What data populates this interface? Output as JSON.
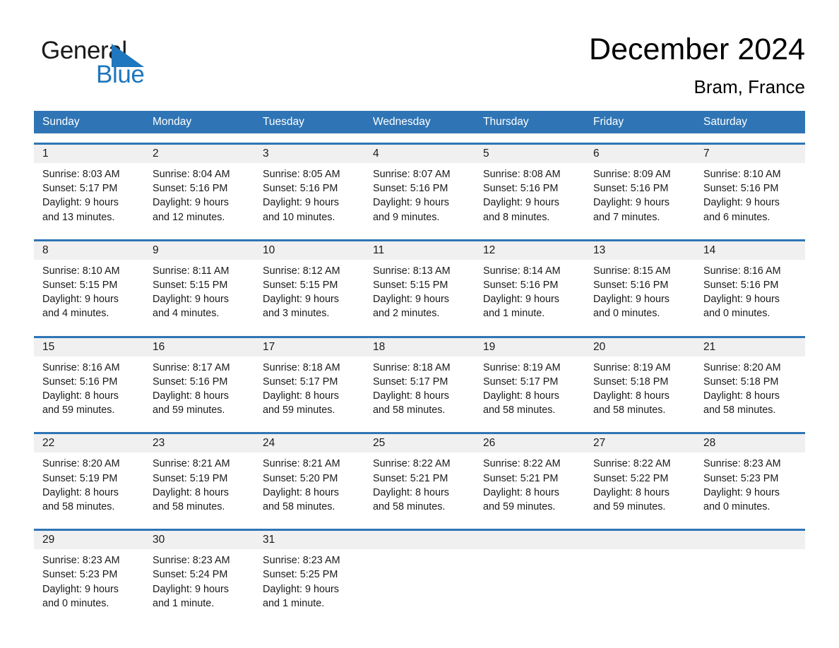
{
  "brand": {
    "name_part1": "General",
    "name_part2": "Blue",
    "logo_icon": "triangle-logo-icon",
    "accent_color": "#1f77bd"
  },
  "header": {
    "title": "December 2024",
    "location": "Bram, France"
  },
  "theme": {
    "header_row_bg": "#2f75b5",
    "daynum_band_bg": "#f0f0f0",
    "week_rule_color": "#2f75b5",
    "text_color": "#1a1a1a"
  },
  "weekdays": [
    "Sunday",
    "Monday",
    "Tuesday",
    "Wednesday",
    "Thursday",
    "Friday",
    "Saturday"
  ],
  "weeks": [
    {
      "daynums": [
        "1",
        "2",
        "3",
        "4",
        "5",
        "6",
        "7"
      ],
      "cells": [
        {
          "l1": "Sunrise: 8:03 AM",
          "l2": "Sunset: 5:17 PM",
          "l3": "Daylight: 9 hours",
          "l4": "and 13 minutes."
        },
        {
          "l1": "Sunrise: 8:04 AM",
          "l2": "Sunset: 5:16 PM",
          "l3": "Daylight: 9 hours",
          "l4": "and 12 minutes."
        },
        {
          "l1": "Sunrise: 8:05 AM",
          "l2": "Sunset: 5:16 PM",
          "l3": "Daylight: 9 hours",
          "l4": "and 10 minutes."
        },
        {
          "l1": "Sunrise: 8:07 AM",
          "l2": "Sunset: 5:16 PM",
          "l3": "Daylight: 9 hours",
          "l4": "and 9 minutes."
        },
        {
          "l1": "Sunrise: 8:08 AM",
          "l2": "Sunset: 5:16 PM",
          "l3": "Daylight: 9 hours",
          "l4": "and 8 minutes."
        },
        {
          "l1": "Sunrise: 8:09 AM",
          "l2": "Sunset: 5:16 PM",
          "l3": "Daylight: 9 hours",
          "l4": "and 7 minutes."
        },
        {
          "l1": "Sunrise: 8:10 AM",
          "l2": "Sunset: 5:16 PM",
          "l3": "Daylight: 9 hours",
          "l4": "and 6 minutes."
        }
      ]
    },
    {
      "daynums": [
        "8",
        "9",
        "10",
        "11",
        "12",
        "13",
        "14"
      ],
      "cells": [
        {
          "l1": "Sunrise: 8:10 AM",
          "l2": "Sunset: 5:15 PM",
          "l3": "Daylight: 9 hours",
          "l4": "and 4 minutes."
        },
        {
          "l1": "Sunrise: 8:11 AM",
          "l2": "Sunset: 5:15 PM",
          "l3": "Daylight: 9 hours",
          "l4": "and 4 minutes."
        },
        {
          "l1": "Sunrise: 8:12 AM",
          "l2": "Sunset: 5:15 PM",
          "l3": "Daylight: 9 hours",
          "l4": "and 3 minutes."
        },
        {
          "l1": "Sunrise: 8:13 AM",
          "l2": "Sunset: 5:15 PM",
          "l3": "Daylight: 9 hours",
          "l4": "and 2 minutes."
        },
        {
          "l1": "Sunrise: 8:14 AM",
          "l2": "Sunset: 5:16 PM",
          "l3": "Daylight: 9 hours",
          "l4": "and 1 minute."
        },
        {
          "l1": "Sunrise: 8:15 AM",
          "l2": "Sunset: 5:16 PM",
          "l3": "Daylight: 9 hours",
          "l4": "and 0 minutes."
        },
        {
          "l1": "Sunrise: 8:16 AM",
          "l2": "Sunset: 5:16 PM",
          "l3": "Daylight: 9 hours",
          "l4": "and 0 minutes."
        }
      ]
    },
    {
      "daynums": [
        "15",
        "16",
        "17",
        "18",
        "19",
        "20",
        "21"
      ],
      "cells": [
        {
          "l1": "Sunrise: 8:16 AM",
          "l2": "Sunset: 5:16 PM",
          "l3": "Daylight: 8 hours",
          "l4": "and 59 minutes."
        },
        {
          "l1": "Sunrise: 8:17 AM",
          "l2": "Sunset: 5:16 PM",
          "l3": "Daylight: 8 hours",
          "l4": "and 59 minutes."
        },
        {
          "l1": "Sunrise: 8:18 AM",
          "l2": "Sunset: 5:17 PM",
          "l3": "Daylight: 8 hours",
          "l4": "and 59 minutes."
        },
        {
          "l1": "Sunrise: 8:18 AM",
          "l2": "Sunset: 5:17 PM",
          "l3": "Daylight: 8 hours",
          "l4": "and 58 minutes."
        },
        {
          "l1": "Sunrise: 8:19 AM",
          "l2": "Sunset: 5:17 PM",
          "l3": "Daylight: 8 hours",
          "l4": "and 58 minutes."
        },
        {
          "l1": "Sunrise: 8:19 AM",
          "l2": "Sunset: 5:18 PM",
          "l3": "Daylight: 8 hours",
          "l4": "and 58 minutes."
        },
        {
          "l1": "Sunrise: 8:20 AM",
          "l2": "Sunset: 5:18 PM",
          "l3": "Daylight: 8 hours",
          "l4": "and 58 minutes."
        }
      ]
    },
    {
      "daynums": [
        "22",
        "23",
        "24",
        "25",
        "26",
        "27",
        "28"
      ],
      "cells": [
        {
          "l1": "Sunrise: 8:20 AM",
          "l2": "Sunset: 5:19 PM",
          "l3": "Daylight: 8 hours",
          "l4": "and 58 minutes."
        },
        {
          "l1": "Sunrise: 8:21 AM",
          "l2": "Sunset: 5:19 PM",
          "l3": "Daylight: 8 hours",
          "l4": "and 58 minutes."
        },
        {
          "l1": "Sunrise: 8:21 AM",
          "l2": "Sunset: 5:20 PM",
          "l3": "Daylight: 8 hours",
          "l4": "and 58 minutes."
        },
        {
          "l1": "Sunrise: 8:22 AM",
          "l2": "Sunset: 5:21 PM",
          "l3": "Daylight: 8 hours",
          "l4": "and 58 minutes."
        },
        {
          "l1": "Sunrise: 8:22 AM",
          "l2": "Sunset: 5:21 PM",
          "l3": "Daylight: 8 hours",
          "l4": "and 59 minutes."
        },
        {
          "l1": "Sunrise: 8:22 AM",
          "l2": "Sunset: 5:22 PM",
          "l3": "Daylight: 8 hours",
          "l4": "and 59 minutes."
        },
        {
          "l1": "Sunrise: 8:23 AM",
          "l2": "Sunset: 5:23 PM",
          "l3": "Daylight: 9 hours",
          "l4": "and 0 minutes."
        }
      ]
    },
    {
      "daynums": [
        "29",
        "30",
        "31",
        "",
        "",
        "",
        ""
      ],
      "cells": [
        {
          "l1": "Sunrise: 8:23 AM",
          "l2": "Sunset: 5:23 PM",
          "l3": "Daylight: 9 hours",
          "l4": "and 0 minutes."
        },
        {
          "l1": "Sunrise: 8:23 AM",
          "l2": "Sunset: 5:24 PM",
          "l3": "Daylight: 9 hours",
          "l4": "and 1 minute."
        },
        {
          "l1": "Sunrise: 8:23 AM",
          "l2": "Sunset: 5:25 PM",
          "l3": "Daylight: 9 hours",
          "l4": "and 1 minute."
        },
        {
          "l1": "",
          "l2": "",
          "l3": "",
          "l4": ""
        },
        {
          "l1": "",
          "l2": "",
          "l3": "",
          "l4": ""
        },
        {
          "l1": "",
          "l2": "",
          "l3": "",
          "l4": ""
        },
        {
          "l1": "",
          "l2": "",
          "l3": "",
          "l4": ""
        }
      ]
    }
  ]
}
